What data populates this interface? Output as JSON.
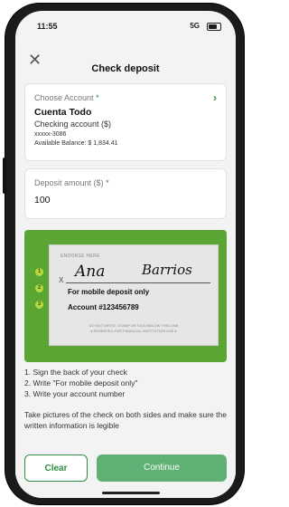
{
  "status_bar": {
    "time": "11:55",
    "network": "5G"
  },
  "header": {
    "title": "Check deposit"
  },
  "account": {
    "label": "Choose Account",
    "required_mark": "*",
    "name": "Cuenta Todo",
    "type": "Checking account ($)",
    "number": "xxxxx-3086",
    "balance": "Available Balance: $ 1,834.41"
  },
  "deposit": {
    "label": "Deposit amount ($)",
    "required_mark": "*",
    "value": "100"
  },
  "check_image": {
    "endorse": "ENDORSE HERE",
    "x_mark": "X",
    "signature_first": "Ana",
    "signature_last": "Barrios",
    "line2": "For mobile deposit only",
    "line3": "Account #123456789",
    "warning1": "DO NOT WRITE, STAMP OR SIGN BELOW THIS LINE",
    "warning2": "♦ RESERVED FOR FINANCIAL INSTITUTION USE ♦",
    "badges": [
      "1",
      "2",
      "3"
    ]
  },
  "instructions": [
    "1. Sign the back of your check",
    "2. Write \"For mobile deposit only\"",
    "3. Write your account number"
  ],
  "tip": "Take pictures of the check on both sides and make sure the written information is legible",
  "footer": {
    "clear": "Clear",
    "continue": "Continue"
  },
  "icons": {
    "close": "close-icon",
    "chevron": "chevron-right-icon",
    "signal": "signal-icon",
    "battery": "battery-icon"
  },
  "colors": {
    "accent": "#2f8d40",
    "panel_green": "#5aa534",
    "continue_bg": "#5eb074"
  }
}
